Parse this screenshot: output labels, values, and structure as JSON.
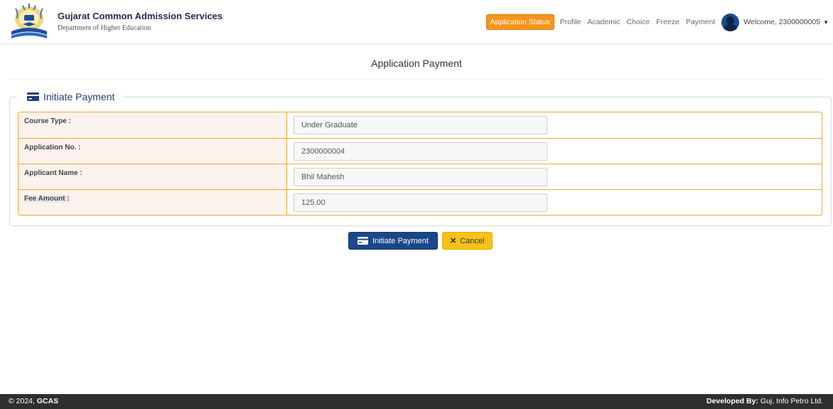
{
  "header": {
    "brand_title": "Gujarat Common Admission Services",
    "brand_subtitle": "Department of Higher Education",
    "logo_text": "GCAS"
  },
  "nav": {
    "active": "Application Status",
    "links": [
      "Profile",
      "Academic",
      "Choice",
      "Freeze",
      "Payment"
    ],
    "welcome": "Welcome, 2300000005"
  },
  "page": {
    "title": "Application Payment"
  },
  "form": {
    "legend": "Initiate Payment",
    "rows": [
      {
        "label": "Course Type :",
        "value": "Under Graduate"
      },
      {
        "label": "Application No. :",
        "value": "2300000004"
      },
      {
        "label": "Applicant Name :",
        "value": "Bhil Mahesh"
      },
      {
        "label": "Fee Amount :",
        "value": "125.00"
      }
    ]
  },
  "buttons": {
    "initiate": "Initiate Payment",
    "cancel": "Cancel"
  },
  "footer": {
    "copyright_prefix": "© 2024, ",
    "copyright_org": "GCAS",
    "developed_prefix": "Developed By: ",
    "developed_by": "Guj. Info Petro Ltd."
  },
  "colors": {
    "primary": "#1a4787",
    "accent": "#f7941d",
    "warning": "#f6c218",
    "table_border": "#f0a830",
    "label_bg": "#fdf3ee",
    "footer_bg": "#2f2f2f"
  }
}
